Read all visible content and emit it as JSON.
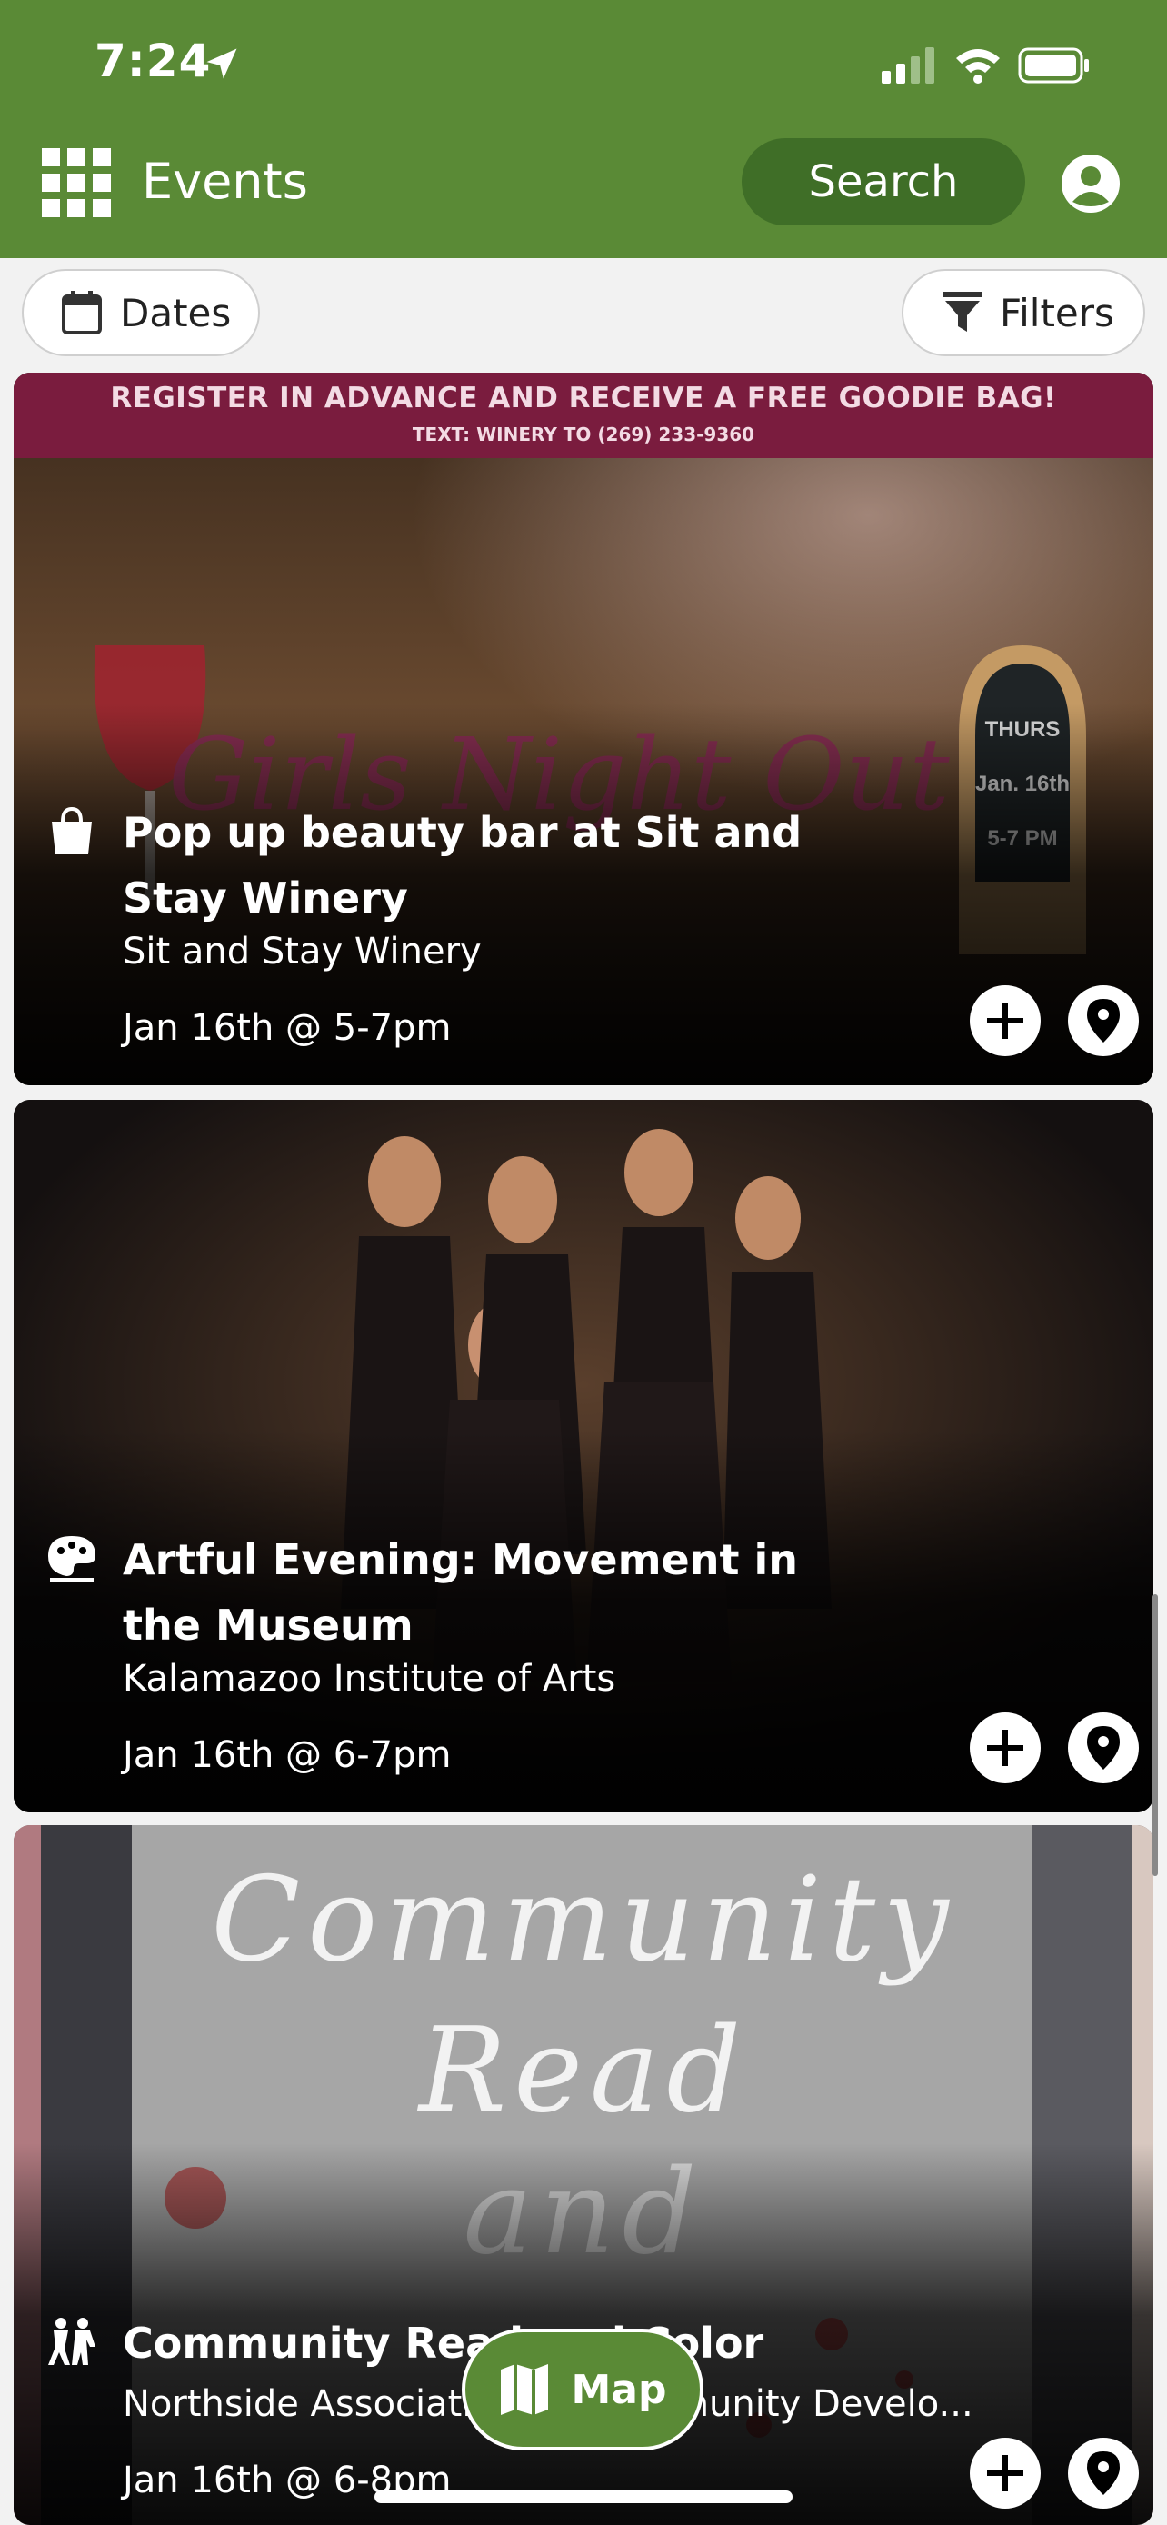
{
  "status_bar": {
    "time": "7:24"
  },
  "header": {
    "title": "Events",
    "search_label": "Search"
  },
  "toolbar": {
    "dates_label": "Dates",
    "filters_label": "Filters"
  },
  "events": [
    {
      "banner_main": "REGISTER IN ADVANCE AND RECEIVE A FREE GOODIE BAG!",
      "banner_sub": "TEXT: WINERY TO (269) 233-9360",
      "title": "Pop up beauty bar at Sit and Stay Winery",
      "venue": "Sit and Stay Winery",
      "date": "Jan 16th @ 5-7pm",
      "category_icon": "shopping-bag-icon"
    },
    {
      "title": "Artful Evening: Movement in the Museum",
      "venue": "Kalamazoo Institute of Arts",
      "date": "Jan 16th @ 6-7pm",
      "category_icon": "palette-icon"
    },
    {
      "title": "Community Read and Color",
      "venue": "Northside Association for Community Develo...",
      "date": "Jan 16th @ 6-8pm",
      "category_icon": "people-icon",
      "poster_text": [
        "Community",
        "Read",
        "and"
      ]
    }
  ],
  "map_button": {
    "label": "Map"
  },
  "colors": {
    "brand_green": "#5a8a36",
    "dark_green": "#3f6e27",
    "banner": "#7a1c3e"
  }
}
